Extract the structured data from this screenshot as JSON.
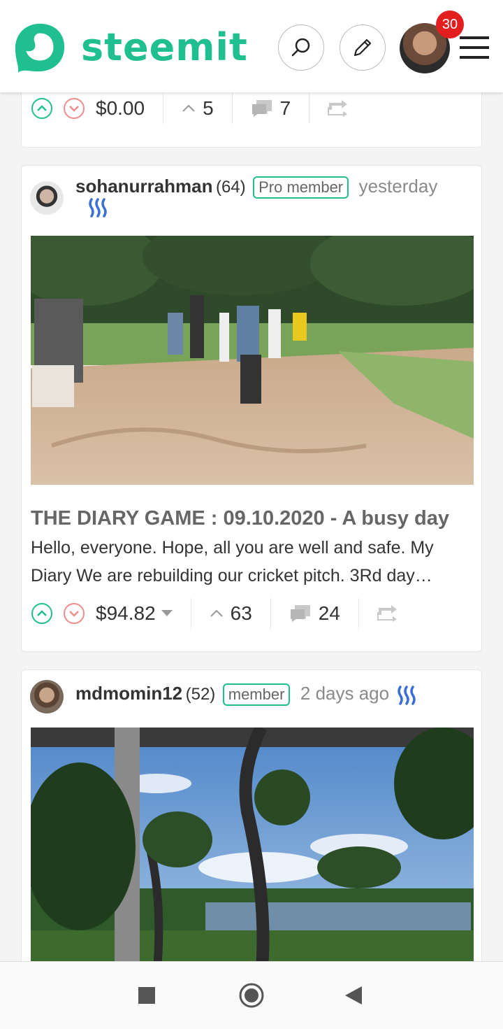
{
  "header": {
    "brand": "steemit",
    "notification_count": "30"
  },
  "card0": {
    "payout": "$0.00",
    "votes": "5",
    "comments": "7"
  },
  "post1": {
    "author": "sohanurrahman",
    "reputation": "(64)",
    "badge": "Pro member",
    "time": "yesterday",
    "title": "THE DIARY GAME : 09.10.2020 - A busy day",
    "excerpt": "Hello, everyone. Hope, all you are well and safe. My Diary We are rebuilding our cricket pitch. 3Rd day…",
    "payout": "$94.82",
    "votes": "63",
    "comments": "24"
  },
  "post2": {
    "author": "mdmomin12",
    "reputation": "(52)",
    "badge": "member",
    "time": "2 days ago"
  },
  "colors": {
    "accent": "#1fbf8f",
    "downvote": "#f18c8c",
    "notification": "#e21e1e"
  }
}
